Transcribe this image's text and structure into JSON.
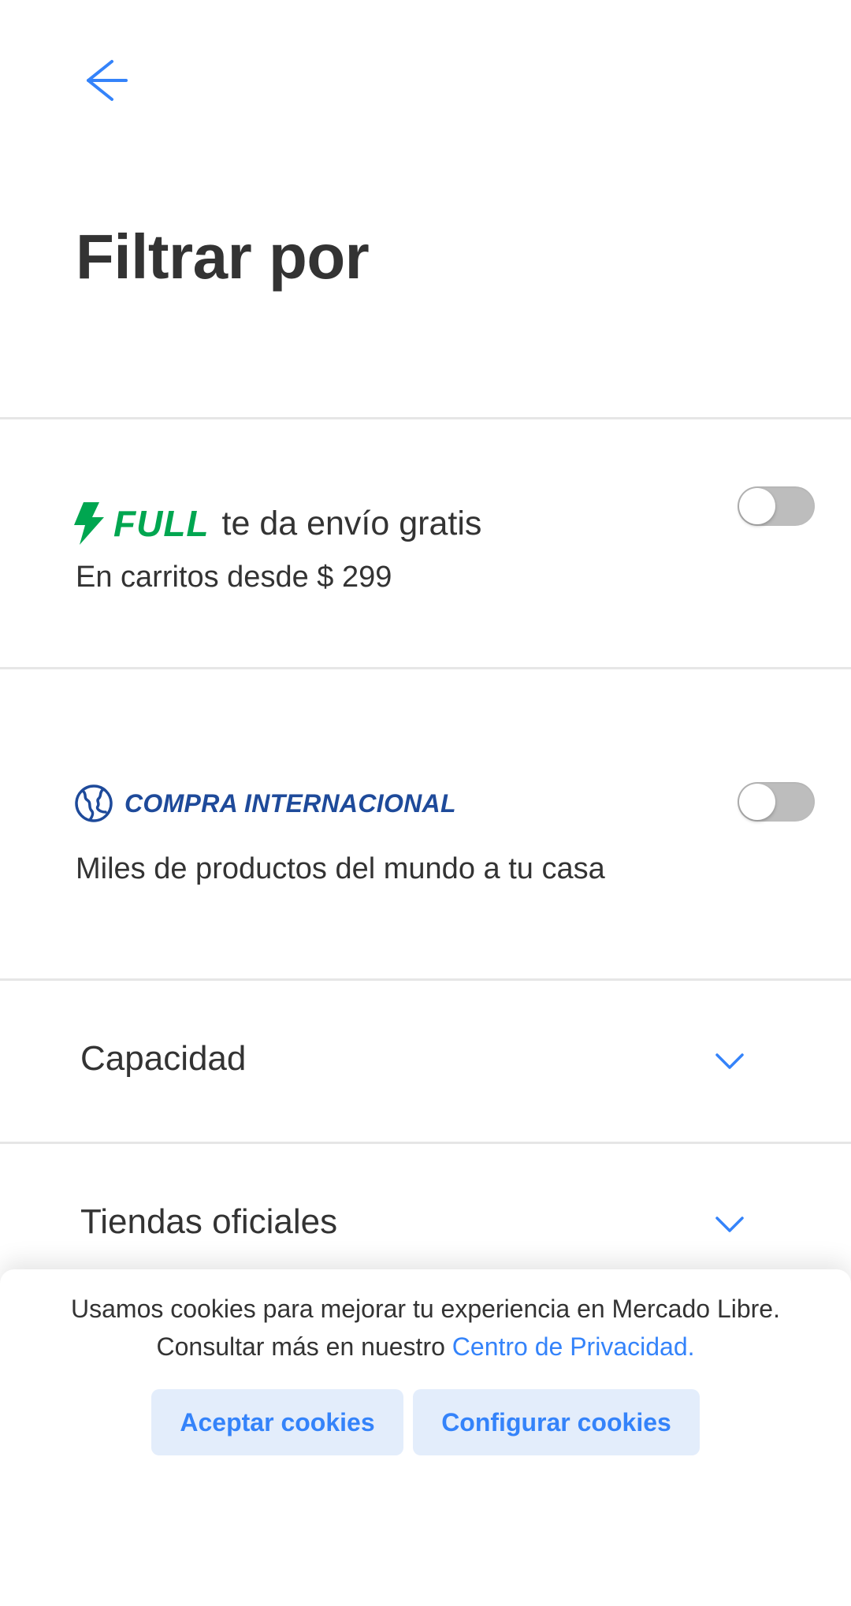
{
  "header": {
    "back_icon": "arrow-left-icon",
    "title": "Filtrar por"
  },
  "filters": {
    "full": {
      "brand": "FULL",
      "text": "te da envío gratis",
      "subtitle": "En carritos desde $ 299",
      "icon": "lightning-bolt-icon",
      "enabled": false
    },
    "international": {
      "brand": "COMPRA INTERNACIONAL",
      "subtitle": "Miles de productos del mundo a tu casa",
      "icon": "globe-icon",
      "enabled": false
    },
    "accordions": [
      {
        "label": "Capacidad",
        "icon": "chevron-down-icon"
      },
      {
        "label": "Tiendas oficiales",
        "icon": "chevron-down-icon"
      }
    ]
  },
  "cookies": {
    "message": "Usamos cookies para mejorar tu experiencia en Mercado Libre. Consultar más en nuestro ",
    "link": "Centro de Privacidad.",
    "accept_label": "Aceptar cookies",
    "configure_label": "Configurar cookies"
  },
  "colors": {
    "accent": "#3483fa",
    "full_green": "#00a650",
    "international_blue": "#1e4a9a",
    "button_bg": "#e3edfb",
    "toggle_off": "#bdbdbd",
    "divider": "#e6e6e6",
    "text": "#333333"
  }
}
